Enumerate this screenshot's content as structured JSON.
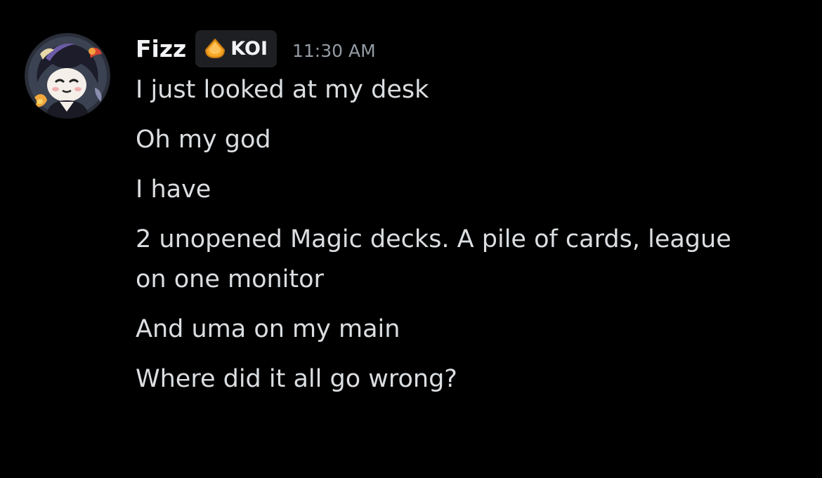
{
  "message": {
    "author": "Fizz",
    "tag": {
      "label": "KOI",
      "icon": "koi-badge-icon",
      "color": "#f5a623"
    },
    "timestamp": "11:30 AM",
    "avatar_icon": "user-avatar",
    "lines": [
      "I just looked at my desk",
      "Oh my god",
      "I have",
      "2 unopened Magic decks. A pile of cards, league on one monitor",
      "And uma on my main",
      "Where did it all go wrong?"
    ]
  },
  "colors": {
    "background": "#000000",
    "username": "#f2f3f5",
    "text": "#dbdee1",
    "timestamp": "#949ba4",
    "tag_background": "#1e1f22"
  }
}
